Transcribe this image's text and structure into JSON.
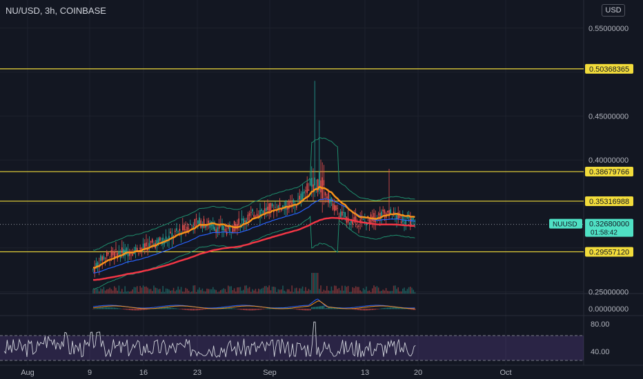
{
  "header": {
    "symbol_title": "NU/USD, 3h, COINBASE",
    "currency": "USD"
  },
  "colors": {
    "background": "#131722",
    "axis_text": "#b2b5be",
    "grid": "#1e222d",
    "level_line": "#f2dc3b",
    "candle_up": "#26a69a",
    "candle_down": "#ef5350",
    "ema_fast": "#f7931a",
    "ema_mid": "#2962ff",
    "ema_slow": "#f23645",
    "bb": "#1f8f6e",
    "rsi_line": "#d1d4dc",
    "rsi_band": "#7e57c2",
    "price_badge": "#4fe0c4",
    "level_badge": "#f2dc3b"
  },
  "main_axis": {
    "ticks": [
      "0.55000000",
      "0.50368365",
      "0.45000000",
      "0.40000000",
      "0.38679766",
      "0.35316988",
      "0.32680000",
      "0.29557120",
      "0.25000000"
    ],
    "ylim": [
      0.245,
      0.56
    ]
  },
  "levels": [
    {
      "value": 0.50368365,
      "label": "0.50368365"
    },
    {
      "value": 0.38679766,
      "label": "0.38679766"
    },
    {
      "value": 0.35316988,
      "label": "0.35316988"
    },
    {
      "value": 0.2955712,
      "label": "0.29557120"
    }
  ],
  "current_price": {
    "value": 0.3268,
    "label": "0.32680000",
    "countdown": "01:58:42",
    "symbol": "NUUSD"
  },
  "macd": {
    "zero_label": "0.00000000"
  },
  "rsi": {
    "ticks": [
      "80.00",
      "40.00"
    ],
    "upper": 70,
    "lower": 30
  },
  "x_axis": {
    "labels": [
      "Aug",
      "9",
      "16",
      "23",
      "Sep",
      "13",
      "20",
      "Oct"
    ]
  },
  "chart_data": {
    "type": "candlestick",
    "symbol": "NU/USD",
    "interval": "3h",
    "exchange": "COINBASE",
    "x_labels": [
      "Aug",
      "9",
      "16",
      "23",
      "Sep",
      "13",
      "20",
      "Oct"
    ],
    "series": [
      {
        "x": "9",
        "values": [
          0.25,
          0.3,
          0.26,
          0.27
        ]
      },
      {
        "x": "16",
        "values": [
          0.27,
          0.32,
          0.29,
          0.3
        ]
      },
      {
        "x": "23",
        "values": [
          0.3,
          0.36,
          0.32,
          0.33
        ]
      },
      {
        "x": "Sep",
        "values": [
          0.33,
          0.38,
          0.34,
          0.35
        ]
      },
      {
        "x": "Sep 6",
        "values": [
          0.34,
          0.48,
          0.33,
          0.38
        ]
      },
      {
        "x": "13",
        "values": [
          0.37,
          0.39,
          0.3,
          0.33
        ]
      },
      {
        "x": "20",
        "values": [
          0.31,
          0.39,
          0.31,
          0.3268
        ]
      }
    ]
  }
}
